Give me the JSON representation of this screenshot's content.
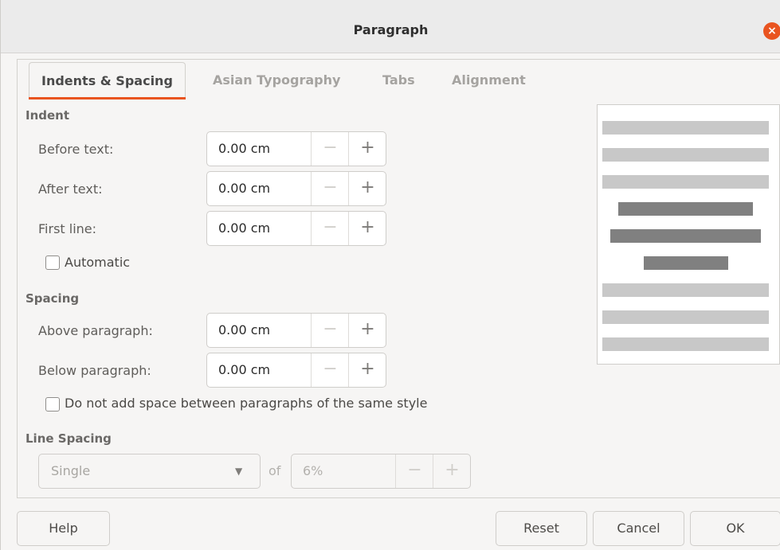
{
  "window": {
    "title": "Paragraph",
    "close_icon": "×"
  },
  "tabs": [
    {
      "label": "Indents & Spacing",
      "active": true
    },
    {
      "label": "Asian Typography",
      "active": false
    },
    {
      "label": "Tabs",
      "active": false
    },
    {
      "label": "Alignment",
      "active": false
    }
  ],
  "indent": {
    "heading": "Indent",
    "before_text": {
      "label": "Before text:",
      "value": "0.00 cm"
    },
    "after_text": {
      "label": "After text:",
      "value": "0.00 cm"
    },
    "first_line": {
      "label": "First line:",
      "value": "0.00 cm"
    },
    "automatic": {
      "label": "Automatic",
      "checked": false
    }
  },
  "spacing": {
    "heading": "Spacing",
    "above": {
      "label": "Above paragraph:",
      "value": "0.00 cm"
    },
    "below": {
      "label": "Below paragraph:",
      "value": "0.00 cm"
    },
    "no_space": {
      "label": "Do not add space between paragraphs of the same style",
      "checked": false
    }
  },
  "line_spacing": {
    "heading": "Line Spacing",
    "mode": "Single",
    "of_label": "of",
    "value": "6%"
  },
  "spin_symbols": {
    "minus": "−",
    "plus": "+"
  },
  "footer": {
    "help": "Help",
    "reset": "Reset",
    "cancel": "Cancel",
    "ok": "OK"
  }
}
